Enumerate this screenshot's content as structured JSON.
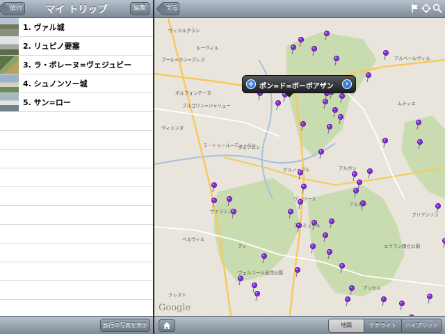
{
  "left_panel": {
    "back_label": "旅行",
    "title": "マイ トリップ",
    "edit_label": "編集",
    "items": [
      {
        "label": "1. ヴァル城"
      },
      {
        "label": "2. リュピノ要塞"
      },
      {
        "label": "3. ラ・ボレーヌ=ヴェジュビー"
      },
      {
        "label": "4. シュノンソー城"
      },
      {
        "label": "5. サン=ロー"
      }
    ],
    "show_photos_label": "旅行の写真を表示"
  },
  "map_panel": {
    "back_label": "戻る",
    "icons": [
      "flag-icon",
      "locate-icon",
      "search-icon"
    ],
    "callout_title": "ポン=ド=ボーボアザン",
    "provider": "Google",
    "map_types": [
      "地図",
      "サテライト",
      "ハイブリッド"
    ],
    "selected_map_type": "地図",
    "place_labels": [
      "ヴィラルグラン",
      "ルーヴィル",
      "ブール=カン=ブレス",
      "ポルフォンテーヌ",
      "ブルゴワン=ジャリュー",
      "ヴィエンヌ",
      "ラ・トゥール=デュ=パン",
      "シャンベリー",
      "ヴォアロン",
      "グルノーブル",
      "ヴィジーユ",
      "アルボン",
      "ヴァランス",
      "ヴェルコール自然公園",
      "エクラン国立公園",
      "ラ・ミュール",
      "ベルヴィル",
      "ディ",
      "クレスト",
      "アンセル",
      "アルベールヴィル",
      "ムティエ",
      "アルモン",
      "ブリアンソン"
    ]
  }
}
